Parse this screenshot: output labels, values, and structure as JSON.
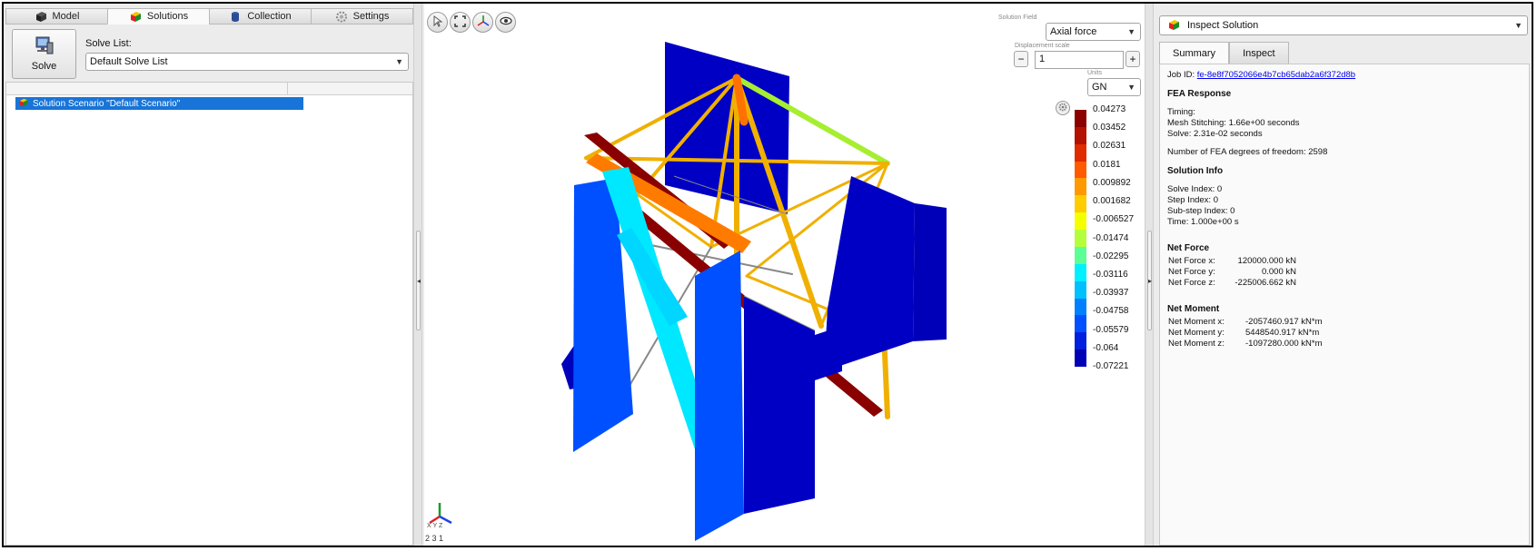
{
  "left_panel": {
    "tabs": [
      {
        "label": "Model",
        "icon": "model-cube-icon"
      },
      {
        "label": "Solutions",
        "icon": "solutions-cube-icon"
      },
      {
        "label": "Collection",
        "icon": "collection-icon"
      },
      {
        "label": "Settings",
        "icon": "gear-icon"
      }
    ],
    "active_tab": "Solutions",
    "solve_button": "Solve",
    "solve_list_label": "Solve List:",
    "solve_list_value": "Default Solve List",
    "tree_items": [
      "Solution Scenario \"Default Scenario\""
    ]
  },
  "viewport": {
    "solution_field_label": "Solution Field",
    "solution_field_value": "Axial force",
    "displacement_scale_label": "Displacement scale",
    "displacement_scale_value": "1",
    "minus_label": "−",
    "plus_label": "+",
    "units_label": "Units",
    "units_value": "GN",
    "legend_values": [
      "0.04273",
      "0.03452",
      "0.02631",
      "0.0181",
      "0.009892",
      "0.001682",
      "-0.006527",
      "-0.01474",
      "-0.02295",
      "-0.03116",
      "-0.03937",
      "-0.04758",
      "-0.05579",
      "-0.064",
      "-0.07221"
    ],
    "legend_colors": [
      "#8b0000",
      "#b41200",
      "#e02a00",
      "#ff5a00",
      "#ff9900",
      "#ffcc00",
      "#f4ff00",
      "#b4ff3c",
      "#5cff96",
      "#00f0ff",
      "#00c0ff",
      "#0080ff",
      "#0050ff",
      "#0020e0",
      "#0000b4"
    ],
    "triad_axes": "X Y Z",
    "coords_readout": "2 3 1"
  },
  "right_panel": {
    "inspect_select": "Inspect Solution",
    "tabs": [
      "Summary",
      "Inspect"
    ],
    "active_tab": "Summary",
    "job_id_label": "Job ID:",
    "job_id": "fe-8e8f7052066e4b7cb65dab2a6f372d8b",
    "fea_response": "FEA Response",
    "timing_label": "Timing:",
    "mesh_stitching": "Mesh Stitching: 1.66e+00 seconds",
    "solve_time": "Solve: 2.31e-02 seconds",
    "dof": "Number of FEA degrees of freedom: 2598",
    "solution_info": "Solution Info",
    "solve_index": "Solve Index: 0",
    "step_index": "Step Index: 0",
    "substep_index": "Sub-step Index: 0",
    "time": "Time: 1.000e+00 s",
    "net_force": "Net Force",
    "net_force_rows": [
      {
        "k": "Net Force x:",
        "v": "120000.000 kN"
      },
      {
        "k": "Net Force y:",
        "v": "0.000 kN"
      },
      {
        "k": "Net Force z:",
        "v": "-225006.662 kN"
      }
    ],
    "net_moment": "Net Moment",
    "net_moment_rows": [
      {
        "k": "Net Moment x:",
        "v": "-2057460.917 kN*m"
      },
      {
        "k": "Net Moment y:",
        "v": "5448540.917 kN*m"
      },
      {
        "k": "Net Moment z:",
        "v": "-1097280.000 kN*m"
      }
    ]
  }
}
